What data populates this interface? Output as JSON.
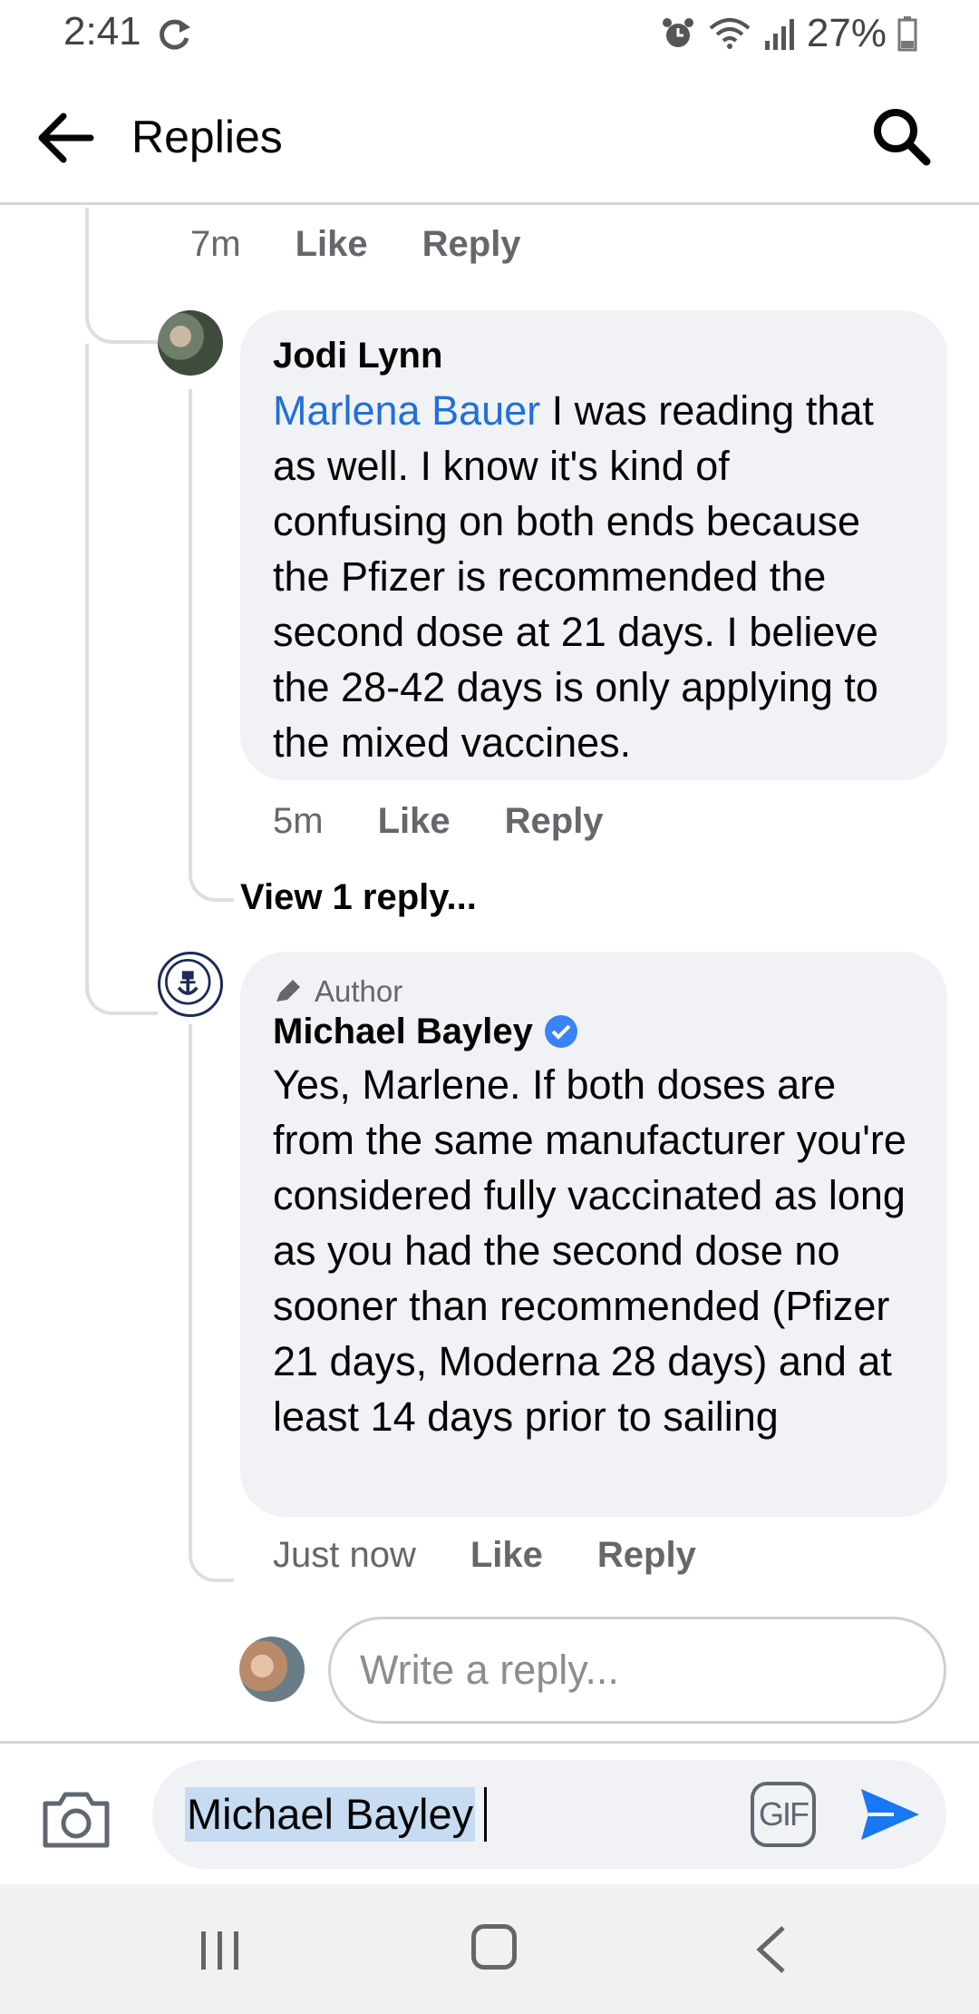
{
  "status_bar": {
    "time": "2:41",
    "battery": "27%",
    "icons": [
      "sync-icon",
      "alarm-icon",
      "wifi-icon",
      "signal-icon",
      "battery-icon"
    ]
  },
  "header": {
    "title": "Replies"
  },
  "top_meta": {
    "time": "7m",
    "like": "Like",
    "reply": "Reply"
  },
  "comments": [
    {
      "author": "Jodi Lynn",
      "mention": "Marlena Bauer",
      "text": " I was reading that as well. I know it's kind of confusing on both ends because the Pfizer is recommended the second dose at 21 days. I believe the 28-42 days is only applying to the mixed vaccines.",
      "time": "5m",
      "like": "Like",
      "reply": "Reply"
    },
    {
      "badge": "Author",
      "author": "Michael Bayley",
      "text": "Yes, Marlene. If both doses are from the same manufacturer you're considered fully vaccinated as long as you had the second dose no sooner than recommended (Pfizer 21 days, Moderna 28 days) and at least 14 days prior to sailing",
      "time": "Just now",
      "like": "Like",
      "reply": "Reply"
    }
  ],
  "view_replies": "View 1 reply...",
  "reply_input": {
    "placeholder": "Write a reply..."
  },
  "composer": {
    "value": "Michael Bayley",
    "gif_label": "GIF"
  },
  "colors": {
    "mention": "#216fdb",
    "bubble": "#f0f2f5",
    "send": "#1877f2",
    "verified": "#3b82f6"
  }
}
